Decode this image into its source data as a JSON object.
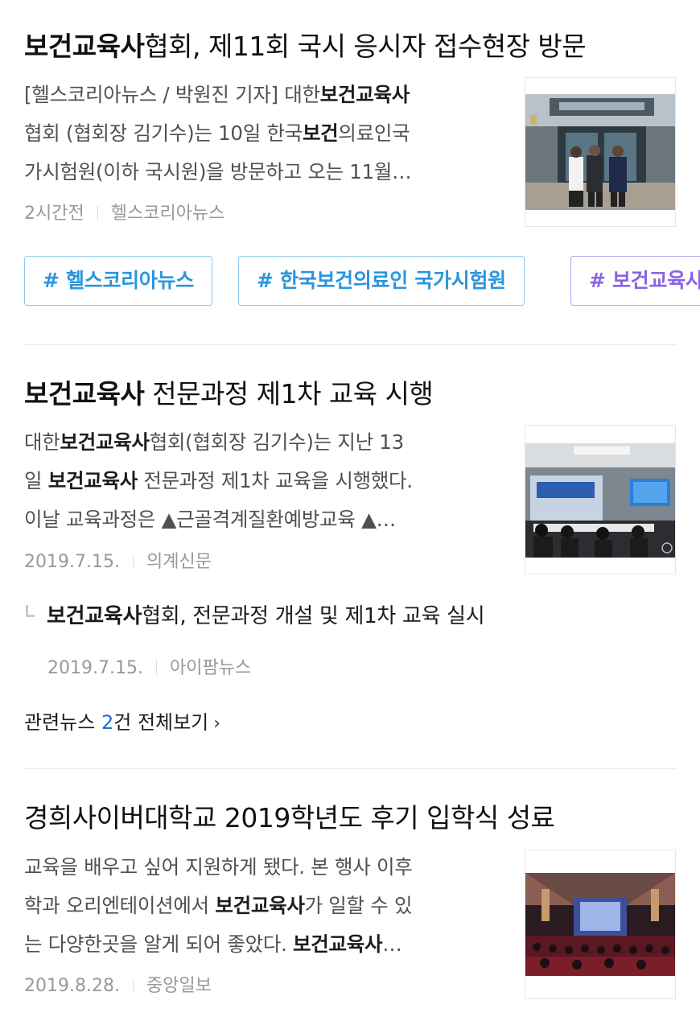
{
  "articles": [
    {
      "title_bold": "보건교육사",
      "title_rest": "협회, 제11회 국시 응시자 접수현장 방문",
      "snippet_line1_a": "[헬스코리아뉴스 / 박원진 기자] 대한",
      "snippet_line1_b": "보건교육사",
      "snippet_line2_a": "협회 (협회장 김기수)는 10일 한국",
      "snippet_line2_b": "보건",
      "snippet_line2_c": "의료인국",
      "snippet_line3": "가시험원(이하 국시원)을 방문하고 오는 11월…",
      "time": "2시간전",
      "source": "헬스코리아뉴스",
      "thumb_icon": "building-photo"
    },
    {
      "title_bold": "보건교육사",
      "title_rest": " 전문과정 제1차 교육 시행",
      "snippet_line1_a": "대한",
      "snippet_line1_b": "보건교육사",
      "snippet_line1_c": "협회(협회장 김기수)는 지난 13",
      "snippet_line2_a": "일 ",
      "snippet_line2_b": "보건교육사",
      "snippet_line2_c": " 전문과정 제1차 교육을 시행했다.",
      "snippet_line3": "이날 교육과정은 ▲근골격계질환예방교육 ▲…",
      "time": "2019.7.15.",
      "source": "의계신문",
      "thumb_icon": "classroom-photo"
    },
    {
      "title_rest": "경희사이버대학교 2019학년도 후기 입학식 성료",
      "snippet_line1": "교육을 배우고 싶어 지원하게 됐다. 본 행사 이후",
      "snippet_line2_a": "학과 오리엔테이션에서 ",
      "snippet_line2_b": "보건교육사",
      "snippet_line2_c": "가 일할 수 있",
      "snippet_line3_a": "는 다양한곳을 알게 되어 좋았다. ",
      "snippet_line3_b": "보건교육사",
      "snippet_line3_c": "…",
      "time": "2019.8.28.",
      "source": "중앙일보",
      "thumb_icon": "auditorium-photo"
    }
  ],
  "tags": [
    "# 헬스코리아뉴스",
    "# 한국보건의료인 국가시험원",
    "# 보건교육사"
  ],
  "related": {
    "title_bold": "보건교육사",
    "title_rest": "협회, 전문과정 개설 및 제1차 교육 실시",
    "time": "2019.7.15.",
    "source": "아이팜뉴스"
  },
  "more": {
    "prefix": "관련뉴스 ",
    "count": "2",
    "suffix": "건 전체보기",
    "chevron": "›"
  },
  "colors": {
    "tag_blue": "#2b95dc",
    "tag_purple": "#8a63e6",
    "link_count": "#1a6fd6"
  }
}
